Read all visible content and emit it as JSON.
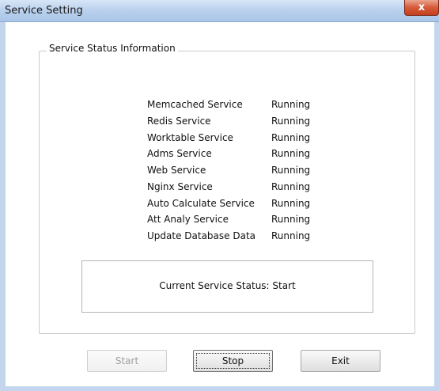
{
  "window": {
    "title": "Service Setting",
    "close_label": "x"
  },
  "group": {
    "legend": "Service Status Information"
  },
  "services": [
    {
      "name": "Memcached Service",
      "status": "Running"
    },
    {
      "name": "Redis Service",
      "status": "Running"
    },
    {
      "name": "Worktable Service",
      "status": "Running"
    },
    {
      "name": "Adms Service",
      "status": "Running"
    },
    {
      "name": "Web Service",
      "status": "Running"
    },
    {
      "name": "Nginx Service",
      "status": "Running"
    },
    {
      "name": "Auto Calculate Service",
      "status": "Running"
    },
    {
      "name": "Att Analy Service",
      "status": "Running"
    },
    {
      "name": "Update Database Data",
      "status": "Running"
    }
  ],
  "current_status": {
    "text": "Current Service Status: Start"
  },
  "buttons": {
    "start": "Start",
    "stop": "Stop",
    "exit": "Exit"
  }
}
